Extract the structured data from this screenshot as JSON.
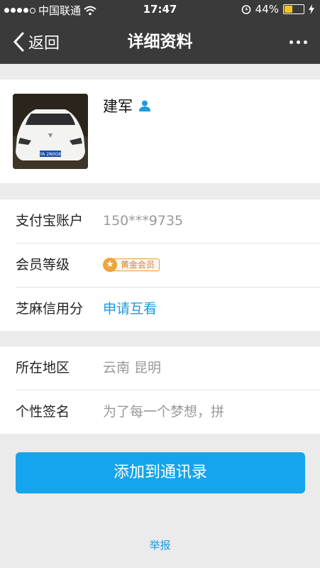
{
  "status": {
    "carrier": "中国联通",
    "time": "17:47",
    "battery": "44%",
    "battery_level": 0.44
  },
  "nav": {
    "back_label": "返回",
    "title": "详细资料"
  },
  "profile": {
    "name": "建军",
    "avatar_plate": "YA 2N0G8"
  },
  "account": {
    "alipay_label": "支付宝账户",
    "alipay_value": "150***9735",
    "level_label": "会员等级",
    "level_value": "黄金会员",
    "sesame_label": "芝麻信用分",
    "sesame_value": "申请互看"
  },
  "info": {
    "region_label": "所在地区",
    "region_value": "云南 昆明",
    "sign_label": "个性签名",
    "sign_value": "为了每一个梦想，拼"
  },
  "actions": {
    "add_button": "添加到通讯录",
    "report": "举报"
  },
  "colors": {
    "accent": "#14a5ec",
    "nav_bg": "#3a3a3a",
    "badge": "#f0a43a"
  }
}
